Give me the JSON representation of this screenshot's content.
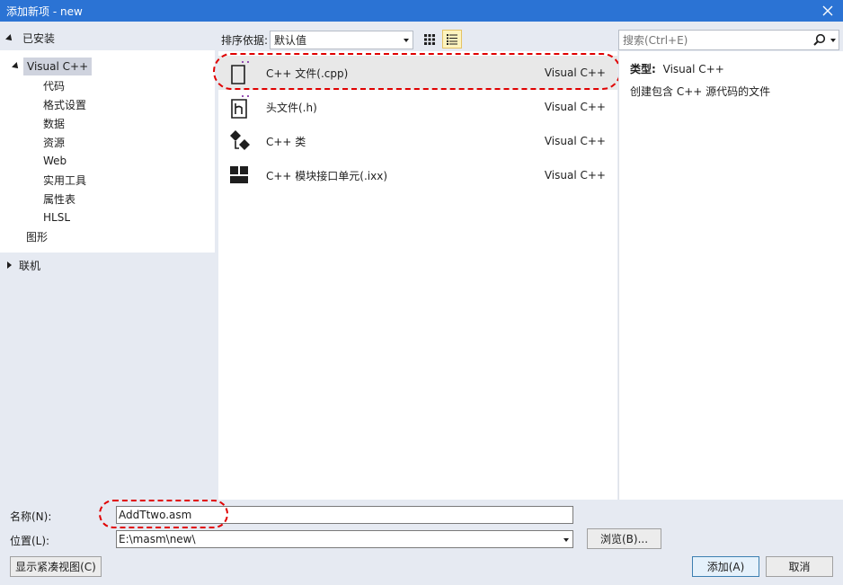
{
  "window": {
    "title": "添加新项 - new",
    "close_icon": "close-icon"
  },
  "left": {
    "installed_label": "已安装",
    "tree": {
      "root": "Visual C++",
      "children": [
        "代码",
        "格式设置",
        "数据",
        "资源",
        "Web",
        "实用工具",
        "属性表",
        "HLSL"
      ],
      "sibling": "图形"
    },
    "online_label": "联机"
  },
  "sortbar": {
    "label": "排序依据:",
    "value": "默认值"
  },
  "templates": [
    {
      "name": "C++ 文件(.cpp)",
      "lang": "Visual C++",
      "icon": "cpp-file-icon"
    },
    {
      "name": "头文件(.h)",
      "lang": "Visual C++",
      "icon": "header-file-icon"
    },
    {
      "name": "C++ 类",
      "lang": "Visual C++",
      "icon": "cpp-class-icon"
    },
    {
      "name": "C++ 模块接口单元(.ixx)",
      "lang": "Visual C++",
      "icon": "module-unit-icon"
    }
  ],
  "search": {
    "placeholder": "搜索(Ctrl+E)"
  },
  "details": {
    "type_label": "类型:",
    "type_value": "Visual C++",
    "description": "创建包含 C++ 源代码的文件"
  },
  "form": {
    "name_label": "名称(N):",
    "name_value": "AddTtwo.asm",
    "location_label": "位置(L):",
    "location_value": "E:\\masm\\new\\",
    "browse_label": "浏览(B)...",
    "compact_label": "显示紧凑视图(C)",
    "add_label": "添加(A)",
    "cancel_label": "取消"
  },
  "colors": {
    "titlebar": "#2b73d4",
    "annotation": "#e00000",
    "accent_plus": "#8e44ad"
  }
}
